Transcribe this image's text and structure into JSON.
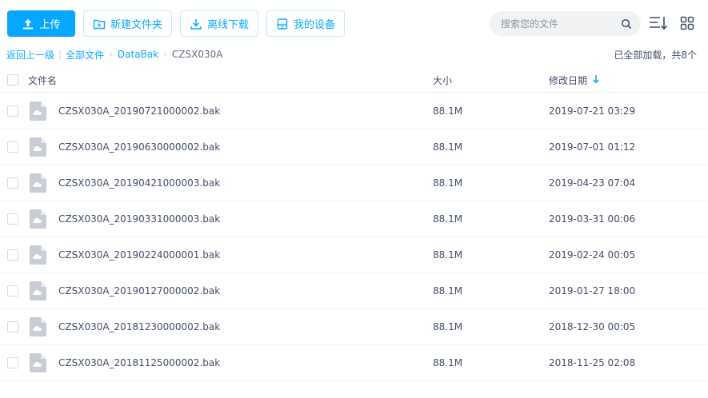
{
  "toolbar": {
    "upload_label": "上传",
    "new_folder_label": "新建文件夹",
    "offline_download_label": "离线下载",
    "my_devices_label": "我的设备"
  },
  "search": {
    "placeholder": "搜索您的文件"
  },
  "breadcrumb": {
    "back_label": "返回上一级",
    "all_files_label": "全部文件",
    "folder_label": "DataBak",
    "current_label": "CZSX030A"
  },
  "status": {
    "loaded_text": "已全部加载，共8个"
  },
  "table": {
    "columns": {
      "name": "文件名",
      "size": "大小",
      "modified": "修改日期"
    },
    "sort": {
      "column": "modified",
      "direction": "desc"
    },
    "rows": [
      {
        "name": "CZSX030A_20190721000002.bak",
        "size": "88.1M",
        "modified": "2019-07-21 03:29"
      },
      {
        "name": "CZSX030A_20190630000002.bak",
        "size": "88.1M",
        "modified": "2019-07-01 01:12"
      },
      {
        "name": "CZSX030A_20190421000003.bak",
        "size": "88.1M",
        "modified": "2019-04-23 07:04"
      },
      {
        "name": "CZSX030A_20190331000003.bak",
        "size": "88.1M",
        "modified": "2019-03-31 00:06"
      },
      {
        "name": "CZSX030A_20190224000001.bak",
        "size": "88.1M",
        "modified": "2019-02-24 00:05"
      },
      {
        "name": "CZSX030A_20190127000002.bak",
        "size": "88.1M",
        "modified": "2019-01-27 18:00"
      },
      {
        "name": "CZSX030A_20181230000002.bak",
        "size": "88.1M",
        "modified": "2018-12-30 00:05"
      },
      {
        "name": "CZSX030A_20181125000002.bak",
        "size": "88.1M",
        "modified": "2018-11-25 02:08"
      }
    ]
  },
  "icons": {
    "upload": "upload-icon",
    "new_folder": "folder-plus-icon",
    "offline_download": "download-icon",
    "devices": "device-icon",
    "search": "search-icon",
    "sort": "sort-list-icon",
    "grid": "grid-view-icon",
    "file": "cloud-file-icon",
    "sort_arrow": "arrow-down-icon"
  },
  "colors": {
    "accent": "#06a7ff",
    "text": "#424e67",
    "file_icon": "#c8cdd5"
  }
}
